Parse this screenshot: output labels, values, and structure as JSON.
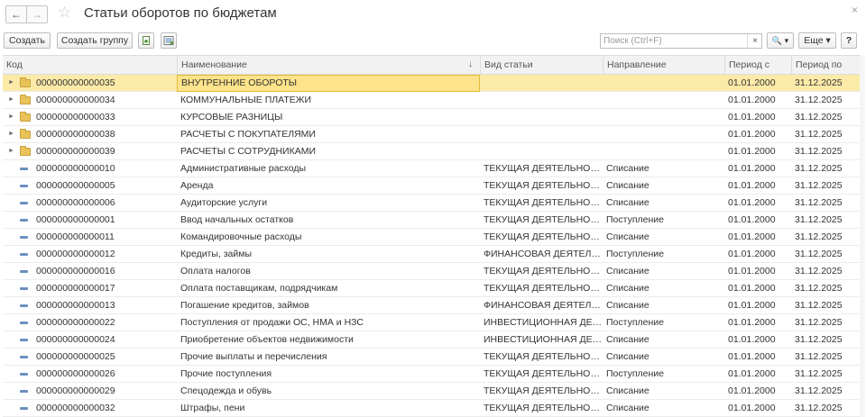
{
  "window": {
    "title": "Статьи оборотов по бюджетам",
    "back_glyph": "←",
    "forward_glyph": "→",
    "favorite_glyph": "☆",
    "close_glyph": "×"
  },
  "toolbar": {
    "create_label": "Создать",
    "create_group_label": "Создать группу",
    "search_placeholder": "Поиск (Ctrl+F)",
    "search_value": "",
    "search_clear_glyph": "×",
    "search_button_label": "🔍 ▾",
    "more_label": "Еще ▾",
    "help_label": "?"
  },
  "table": {
    "columns": [
      "Код",
      "Наименование",
      "Вид статьи",
      "Направление",
      "Период с",
      "Период по"
    ],
    "sort_indicator": "↓",
    "selected_row": 0,
    "rows": [
      {
        "type": "group",
        "code": "000000000000035",
        "name": "ВНУТРЕННИЕ ОБОРОТЫ",
        "kind": "",
        "direction": "",
        "from": "01.01.2000",
        "to": "31.12.2025"
      },
      {
        "type": "group",
        "code": "000000000000034",
        "name": "КОММУНАЛЬНЫЕ ПЛАТЕЖИ",
        "kind": "",
        "direction": "",
        "from": "01.01.2000",
        "to": "31.12.2025"
      },
      {
        "type": "group",
        "code": "000000000000033",
        "name": "КУРСОВЫЕ РАЗНИЦЫ",
        "kind": "",
        "direction": "",
        "from": "01.01.2000",
        "to": "31.12.2025"
      },
      {
        "type": "group",
        "code": "000000000000038",
        "name": "РАСЧЕТЫ С ПОКУПАТЕЛЯМИ",
        "kind": "",
        "direction": "",
        "from": "01.01.2000",
        "to": "31.12.2025"
      },
      {
        "type": "group",
        "code": "000000000000039",
        "name": "РАСЧЕТЫ С СОТРУДНИКАМИ",
        "kind": "",
        "direction": "",
        "from": "01.01.2000",
        "to": "31.12.2025"
      },
      {
        "type": "item",
        "code": "000000000000010",
        "name": "Административные расходы",
        "kind": "ТЕКУЩАЯ ДЕЯТЕЛЬНОСТЬ",
        "direction": "Списание",
        "from": "01.01.2000",
        "to": "31.12.2025"
      },
      {
        "type": "item",
        "code": "000000000000005",
        "name": "Аренда",
        "kind": "ТЕКУЩАЯ ДЕЯТЕЛЬНОСТЬ",
        "direction": "Списание",
        "from": "01.01.2000",
        "to": "31.12.2025"
      },
      {
        "type": "item",
        "code": "000000000000006",
        "name": "Аудиторские услуги",
        "kind": "ТЕКУЩАЯ ДЕЯТЕЛЬНОСТЬ",
        "direction": "Списание",
        "from": "01.01.2000",
        "to": "31.12.2025"
      },
      {
        "type": "item",
        "code": "000000000000001",
        "name": "Ввод начальных остатков",
        "kind": "ТЕКУЩАЯ ДЕЯТЕЛЬНОСТЬ",
        "direction": "Поступление",
        "from": "01.01.2000",
        "to": "31.12.2025"
      },
      {
        "type": "item",
        "code": "000000000000011",
        "name": "Командировочные расходы",
        "kind": "ТЕКУЩАЯ ДЕЯТЕЛЬНОСТЬ",
        "direction": "Списание",
        "from": "01.01.2000",
        "to": "31.12.2025"
      },
      {
        "type": "item",
        "code": "000000000000012",
        "name": "Кредиты, займы",
        "kind": "ФИНАНСОВАЯ ДЕЯТЕЛЬН...",
        "direction": "Поступление",
        "from": "01.01.2000",
        "to": "31.12.2025"
      },
      {
        "type": "item",
        "code": "000000000000016",
        "name": "Оплата налогов",
        "kind": "ТЕКУЩАЯ ДЕЯТЕЛЬНОСТЬ",
        "direction": "Списание",
        "from": "01.01.2000",
        "to": "31.12.2025"
      },
      {
        "type": "item",
        "code": "000000000000017",
        "name": "Оплата поставщикам, подрядчикам",
        "kind": "ТЕКУЩАЯ ДЕЯТЕЛЬНОСТЬ",
        "direction": "Списание",
        "from": "01.01.2000",
        "to": "31.12.2025"
      },
      {
        "type": "item",
        "code": "000000000000013",
        "name": "Погашение кредитов, займов",
        "kind": "ФИНАНСОВАЯ ДЕЯТЕЛЬН...",
        "direction": "Списание",
        "from": "01.01.2000",
        "to": "31.12.2025"
      },
      {
        "type": "item",
        "code": "000000000000022",
        "name": "Поступления от продажи ОС, НМА и НЗС",
        "kind": "ИНВЕСТИЦИОННАЯ ДЕЯТ...",
        "direction": "Поступление",
        "from": "01.01.2000",
        "to": "31.12.2025"
      },
      {
        "type": "item",
        "code": "000000000000024",
        "name": "Приобретение объектов недвижимости",
        "kind": "ИНВЕСТИЦИОННАЯ ДЕЯТ...",
        "direction": "Списание",
        "from": "01.01.2000",
        "to": "31.12.2025"
      },
      {
        "type": "item",
        "code": "000000000000025",
        "name": "Прочие выплаты и перечисления",
        "kind": "ТЕКУЩАЯ ДЕЯТЕЛЬНОСТЬ",
        "direction": "Списание",
        "from": "01.01.2000",
        "to": "31.12.2025"
      },
      {
        "type": "item",
        "code": "000000000000026",
        "name": "Прочие поступления",
        "kind": "ТЕКУЩАЯ ДЕЯТЕЛЬНОСТЬ",
        "direction": "Поступление",
        "from": "01.01.2000",
        "to": "31.12.2025"
      },
      {
        "type": "item",
        "code": "000000000000029",
        "name": "Спецодежда и обувь",
        "kind": "ТЕКУЩАЯ ДЕЯТЕЛЬНОСТЬ",
        "direction": "Списание",
        "from": "01.01.2000",
        "to": "31.12.2025"
      },
      {
        "type": "item",
        "code": "000000000000032",
        "name": "Штрафы, пени",
        "kind": "ТЕКУЩАЯ ДЕЯТЕЛЬНОСТЬ",
        "direction": "Списание",
        "from": "01.01.2000",
        "to": "31.12.2025"
      }
    ]
  },
  "colors": {
    "selected_row": "#fbeaa8",
    "focused_cell": "#fde38a",
    "folder": "#e9c35a",
    "item_marker": "#6b8fbf"
  },
  "icons": {
    "nav_back": "arrow-left-icon",
    "nav_forward": "arrow-right-icon",
    "favorite": "star-icon",
    "close": "close-icon",
    "copy": "copy-document-icon",
    "edit_list": "edit-list-icon",
    "search": "search-icon",
    "group_row": "folder-icon",
    "item_row": "dash-icon"
  }
}
